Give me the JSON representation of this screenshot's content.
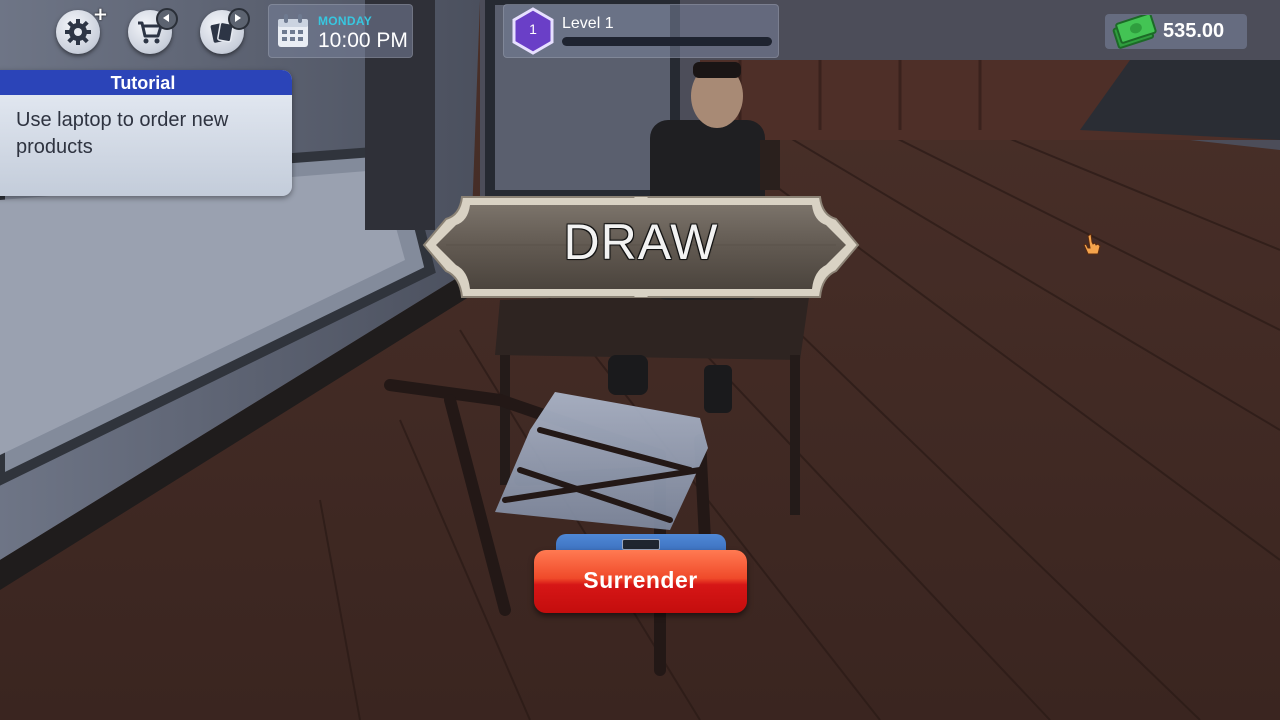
{
  "hud": {
    "settings_icon": "gear-icon",
    "shop_icon": "cart-icon",
    "cards_icon": "cards-icon",
    "day": "MONDAY",
    "time": "10:00 PM",
    "level_number": "1",
    "level_label": "Level 1",
    "level_progress": 0,
    "money": "535.00"
  },
  "tutorial": {
    "title": "Tutorial",
    "text_line1": "Use laptop to order new",
    "text_line2": "products"
  },
  "result": {
    "label": "DRAW"
  },
  "actions": {
    "surrender_label": "Surrender"
  },
  "colors": {
    "tutorial_header": "#2b44b8",
    "day_text": "#37c7e0",
    "level_hex": "#6a3fc7",
    "surrender_button": "#e02a1c",
    "surrender_tab": "#4577c8"
  }
}
